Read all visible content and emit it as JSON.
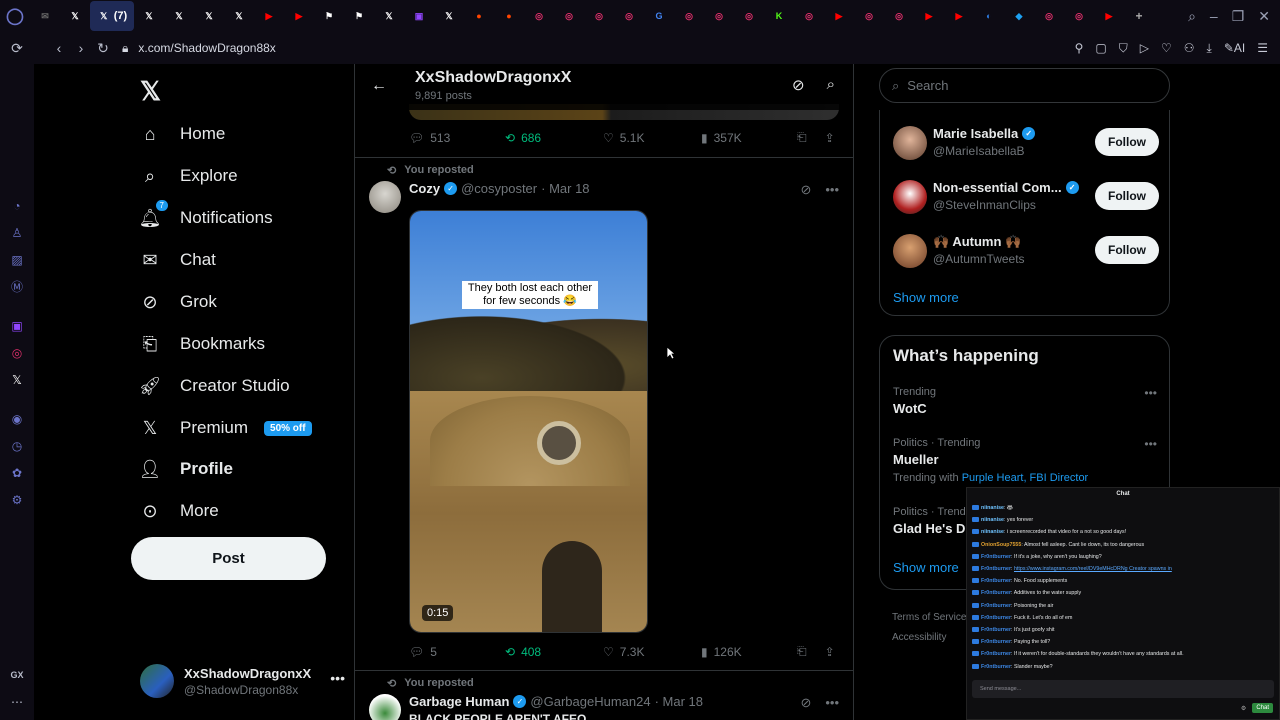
{
  "browser": {
    "active_tab_label": "(7)",
    "url": "x.com/ShadowDragon88x",
    "ai_label": "AI",
    "tab_icons": [
      "mail",
      "x",
      "x-active",
      "x",
      "x",
      "x",
      "x",
      "youtube",
      "youtube",
      "flag",
      "flag",
      "x",
      "twitch",
      "x",
      "reddit",
      "reddit",
      "instagram",
      "instagram",
      "instagram",
      "instagram",
      "google",
      "instagram",
      "instagram",
      "instagram",
      "kick",
      "instagram",
      "youtube",
      "instagram",
      "instagram",
      "youtube",
      "youtube",
      "edge",
      "twitter-blue",
      "instagram",
      "instagram",
      "youtube"
    ],
    "colors": {
      "bg": "#0d0b14",
      "active_tab": "#1f2a56"
    }
  },
  "left_nav": {
    "items": [
      {
        "label": "Home",
        "icon": "home-icon"
      },
      {
        "label": "Explore",
        "icon": "search-icon"
      },
      {
        "label": "Notifications",
        "icon": "bell-icon",
        "badge": "7"
      },
      {
        "label": "Chat",
        "icon": "mail-icon"
      },
      {
        "label": "Grok",
        "icon": "grok-icon"
      },
      {
        "label": "Bookmarks",
        "icon": "bookmark-icon"
      },
      {
        "label": "Creator Studio",
        "icon": "rocket-icon"
      },
      {
        "label": "Premium",
        "icon": "x-logo-icon",
        "promo": "50% off"
      },
      {
        "label": "Profile",
        "icon": "person-icon"
      },
      {
        "label": "More",
        "icon": "more-circle-icon"
      }
    ],
    "post_button": "Post",
    "account": {
      "display_name": "XxShadowDragonxX",
      "handle": "@ShadowDragon88x"
    }
  },
  "header": {
    "title": "XxShadowDragonxX",
    "posts_count": "9,891 posts"
  },
  "top_post_actions": {
    "replies": "513",
    "reposts": "686",
    "likes": "5.1K",
    "views": "357K"
  },
  "tweet1": {
    "repost_label": "You reposted",
    "name": "Cozy",
    "handle": "@cosyposter",
    "date": "· Mar 18",
    "caption": "They both lost each other for few seconds 😂",
    "duration": "0:15",
    "replies": "5",
    "reposts": "408",
    "likes": "7.3K",
    "views": "126K"
  },
  "tweet2": {
    "repost_label": "You reposted",
    "name": "Garbage Human",
    "handle": "@GarbageHuman24",
    "date": "· Mar 18",
    "text": "BLACK PEOPLE AREN'T AFEO"
  },
  "right": {
    "search_placeholder": "Search",
    "follow_suggestions": [
      {
        "name": "Marie Isabella",
        "handle": "@MarieIsabellaB",
        "verified": true,
        "button": "Follow"
      },
      {
        "name": "Non-essential Com...",
        "handle": "@SteveInmanClips",
        "verified": true,
        "button": "Follow"
      },
      {
        "name": "🙌🏾 Autumn 🙌🏾",
        "handle": "@AutumnTweets",
        "verified": false,
        "button": "Follow"
      }
    ],
    "show_more": "Show more",
    "happening_title": "What’s happening",
    "trends": [
      {
        "context": "Trending",
        "title": "WotC",
        "with": ""
      },
      {
        "context": "Politics · Trending",
        "title": "Mueller",
        "with_label": "Trending with",
        "with": "Purple Heart, FBI Director"
      },
      {
        "context": "Politics · Trend",
        "title": "Glad He's De",
        "with": ""
      }
    ],
    "show_more_2": "Show more",
    "footer": [
      "Terms of Service",
      "Accessibility"
    ]
  },
  "chat": {
    "title": "Chat",
    "messages": [
      {
        "user": "niinanise",
        "text": "🦝"
      },
      {
        "user": "niinanise",
        "text": "yes forever"
      },
      {
        "user": "niinanise",
        "text": "i screenrecorded that video for a not so good days!"
      },
      {
        "user": "OnionSoup7555",
        "text": "Almost fell asleep. Cant lie down, its too dangerous"
      },
      {
        "user": "Fr0ntburner",
        "text": "If it's a joke, why aren't you laughing?"
      },
      {
        "user": "Fr0ntburner",
        "text": "https://www.instagram.com/reel/DV9eMHcDRNg Creator spawns in"
      },
      {
        "user": "Fr0ntburner",
        "text": "No. Food supplements"
      },
      {
        "user": "Fr0ntburner",
        "text": "Additives to the water supply"
      },
      {
        "user": "Fr0ntburner",
        "text": "Poisoning the air"
      },
      {
        "user": "Fr0ntburner",
        "text": "Fuck it. Let's do all of em"
      },
      {
        "user": "Fr0ntburner",
        "text": "It's just goofy shit"
      },
      {
        "user": "Fr0ntburner",
        "text": "Paying the toll?"
      },
      {
        "user": "Fr0ntburner",
        "text": "If it weren't for double-standards they wouldn't have any standards at all."
      },
      {
        "user": "Fr0ntburner",
        "text": "Slander maybe?"
      }
    ],
    "input_placeholder": "Send message...",
    "send_label": "Chat",
    "colors": {
      "onion": "#e0a030",
      "niina": "#6fc3ff",
      "front": "#3d88e6"
    }
  }
}
